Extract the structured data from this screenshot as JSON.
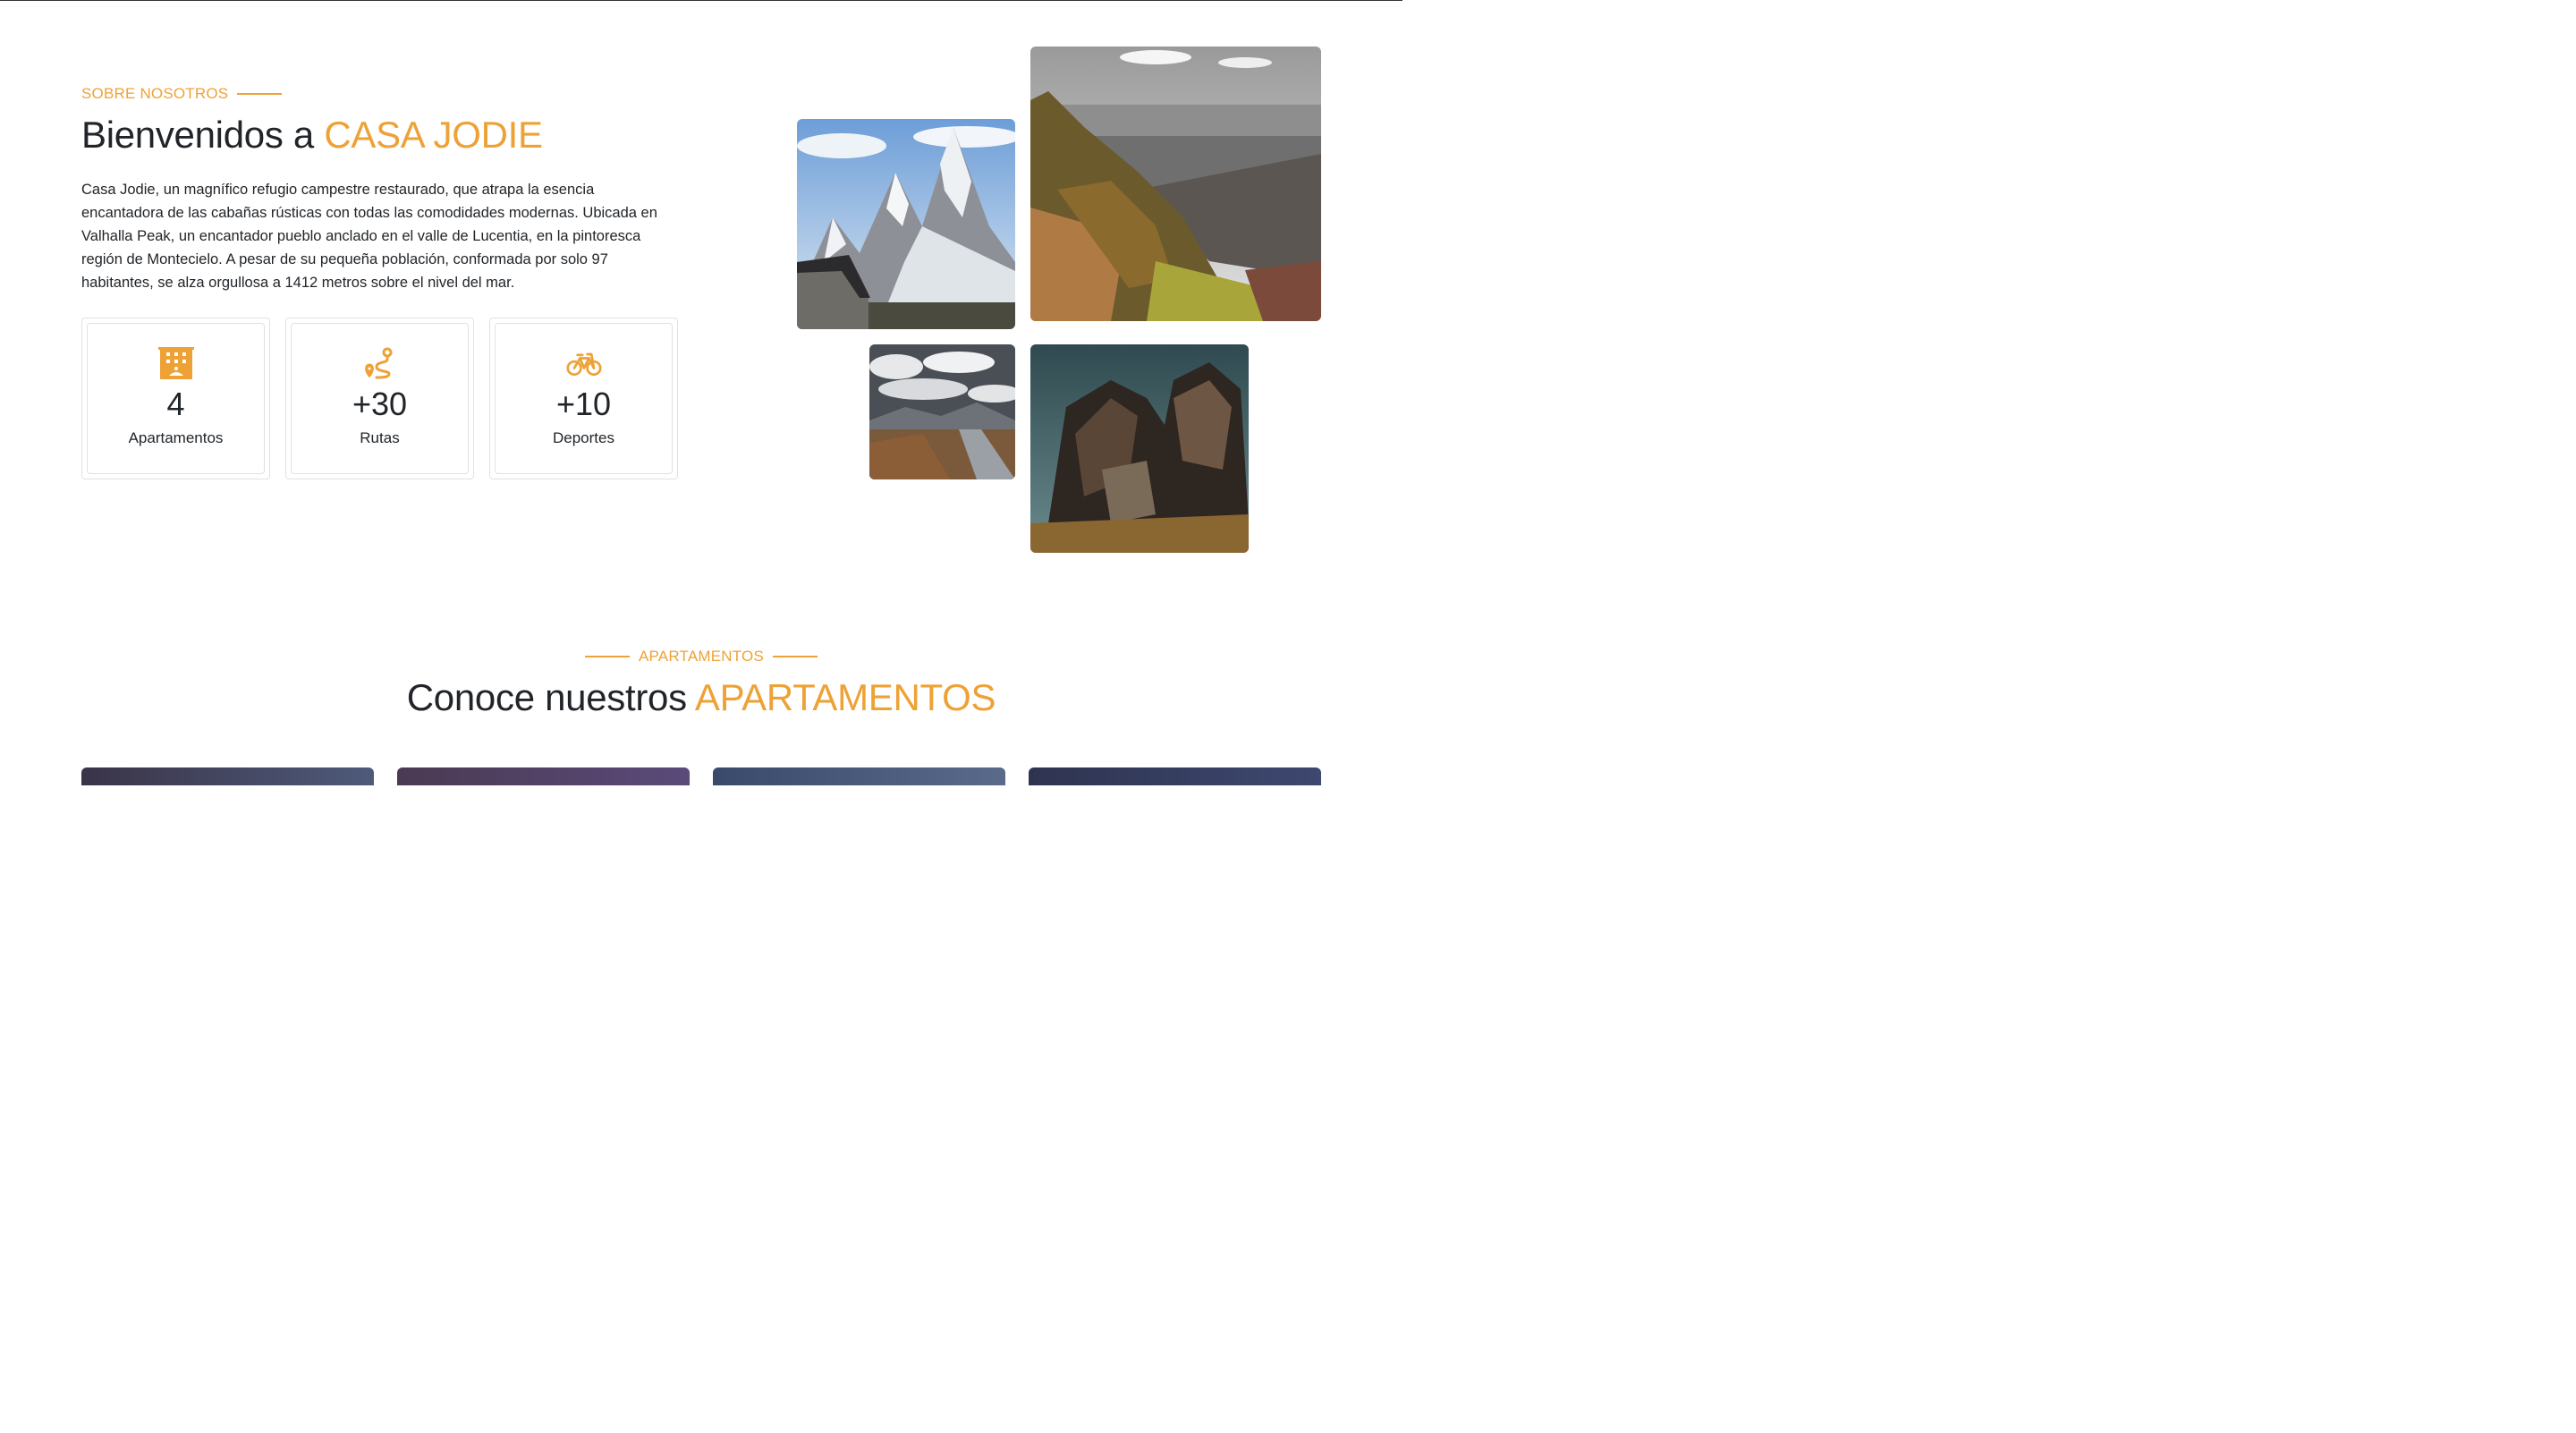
{
  "about": {
    "eyebrow": "SOBRE NOSOTROS",
    "title_prefix": "Bienvenidos a ",
    "title_accent": "CASA JODIE",
    "description": "Casa Jodie, un magnífico refugio campestre restaurado, que atrapa la esencia encantadora de las cabañas rústicas con todas las comodidades modernas. Ubicada en Valhalla Peak, un encantador pueblo anclado en el valle de Lucentia, en la pintoresca región de Montecielo. A pesar de su pequeña población, conformada por solo 97 habitantes, se alza orgullosa a 1412 metros sobre el nivel del mar.",
    "stats": [
      {
        "icon": "building-icon",
        "value": "4",
        "label": "Apartamentos"
      },
      {
        "icon": "route-icon",
        "value": "+30",
        "label": "Rutas"
      },
      {
        "icon": "bicycle-icon",
        "value": "+10",
        "label": "Deportes"
      }
    ]
  },
  "gallery": [
    {
      "name": "snowy-mountain-cabin-photo"
    },
    {
      "name": "valley-cliff-photo"
    },
    {
      "name": "cloudy-road-photo"
    },
    {
      "name": "rock-formation-photo"
    }
  ],
  "apartments": {
    "eyebrow": "APARTAMENTOS",
    "title_prefix": "Conoce nuestros ",
    "title_accent": "APARTAMENTOS"
  },
  "colors": {
    "accent": "#eea236",
    "text": "#212529",
    "border": "#dee2e6"
  }
}
